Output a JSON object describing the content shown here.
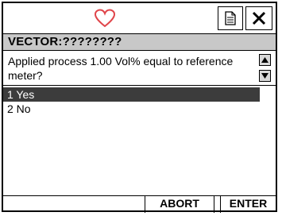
{
  "header": {
    "icons": [
      "heart-icon",
      "document-icon",
      "close-icon"
    ],
    "heart_color": "#e0454a"
  },
  "title_bar": {
    "title": "VECTOR:????????"
  },
  "prompt": {
    "text": "Applied process 1.00 Vol% equal to reference meter?"
  },
  "options": [
    {
      "label": "1 Yes",
      "selected": true
    },
    {
      "label": "2 No",
      "selected": false
    }
  ],
  "footer": {
    "abort_label": "ABORT",
    "enter_label": "ENTER"
  },
  "colors": {
    "title_bg": "#c8c8c8",
    "selection_bg": "#3c3c3c"
  }
}
